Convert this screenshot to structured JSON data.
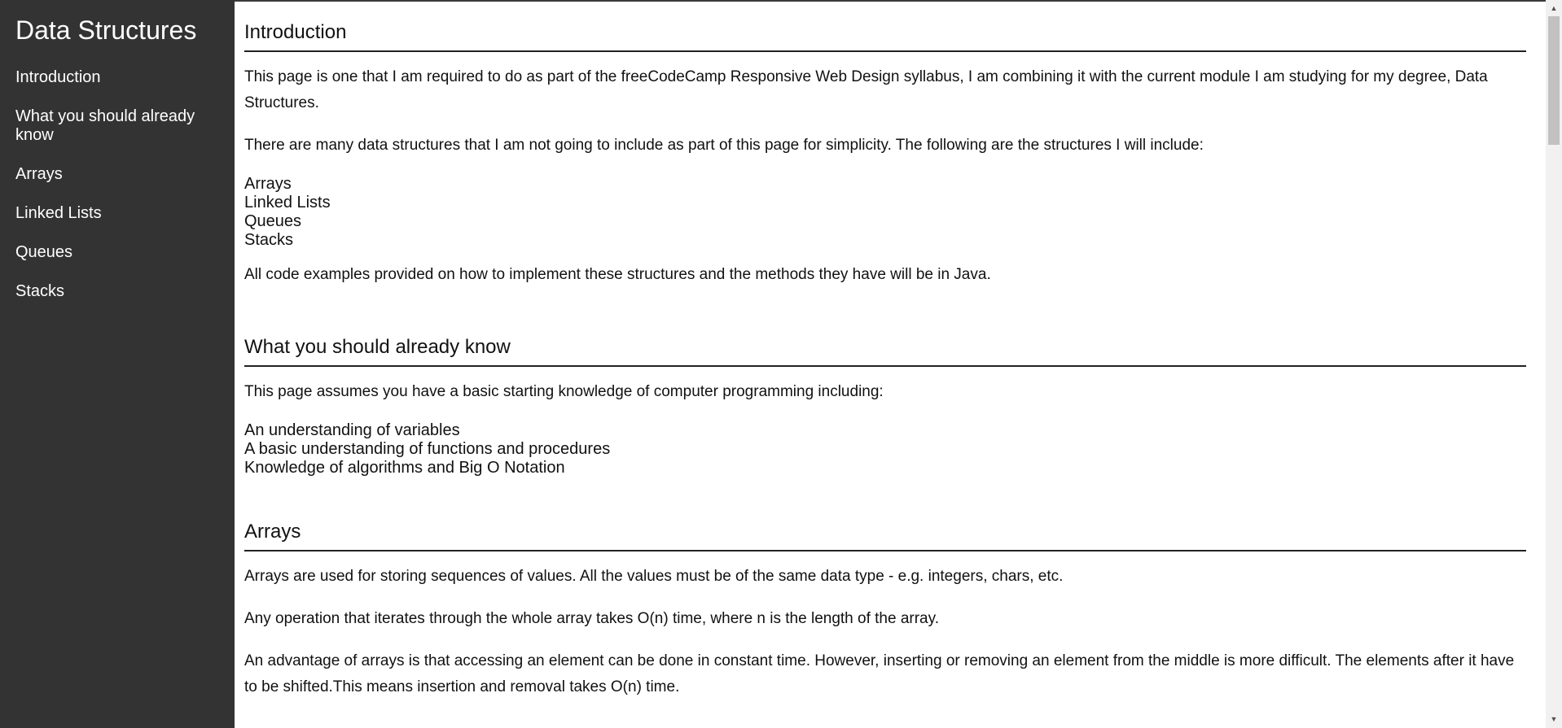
{
  "nav": {
    "title": "Data Structures",
    "items": [
      {
        "label": "Introduction"
      },
      {
        "label": "What you should already know"
      },
      {
        "label": "Arrays"
      },
      {
        "label": "Linked Lists"
      },
      {
        "label": "Queues"
      },
      {
        "label": "Stacks"
      }
    ]
  },
  "sections": {
    "introduction": {
      "header": "Introduction",
      "p1": "This page is one that I am required to do as part of the freeCodeCamp Responsive Web Design syllabus, I am combining it with the current module I am studying for my degree, Data Structures.",
      "p2": "There are many data structures that I am not going to include as part of this page for simplicity. The following are the structures I will include:",
      "list": [
        "Arrays",
        "Linked Lists",
        "Queues",
        "Stacks"
      ],
      "p3": "All code examples provided on how to implement these structures and the methods they have will be in Java."
    },
    "prerequisites": {
      "header": "What you should already know",
      "p1": "This page assumes you have a basic starting knowledge of computer programming including:",
      "list": [
        "An understanding of variables",
        "A basic understanding of functions and procedures",
        "Knowledge of algorithms and Big O Notation"
      ]
    },
    "arrays": {
      "header": "Arrays",
      "p1": "Arrays are used for storing sequences of values. All the values must be of the same data type - e.g. integers, chars, etc.",
      "p2": "Any operation that iterates through the whole array takes O(n) time, where n is the length of the array.",
      "p3": "An advantage of arrays is that accessing an element can be done in constant time. However, inserting or removing an element from the middle is more difficult. The elements after it have to be shifted.This means insertion and removal takes O(n) time."
    }
  },
  "scrollbar": {
    "up_arrow": "▲",
    "down_arrow": "▼"
  }
}
